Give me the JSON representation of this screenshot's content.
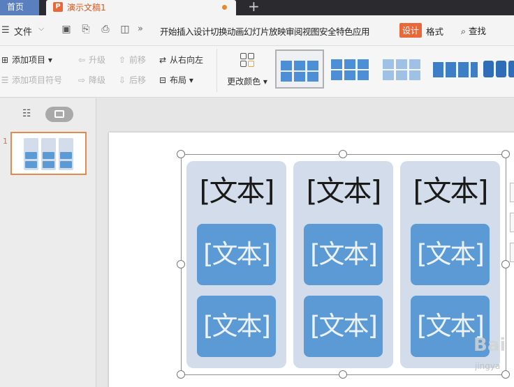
{
  "tabs": {
    "home": "首页",
    "document": "演示文稿1",
    "doc_logo": "P",
    "add": "+"
  },
  "menubar": {
    "file": "文件",
    "more": "»",
    "items": "开始插入设计切换动画幻灯片放映审阅视图安全特色应用",
    "design": "设计",
    "format": "格式",
    "search": "查找"
  },
  "ribbon": {
    "add_item": "添加项目",
    "add_bullet": "添加项目符号",
    "promote": "升级",
    "demote": "降级",
    "move_up": "前移",
    "move_down": "后移",
    "right_to_left": "从右向左",
    "layout": "布局",
    "change_color": "更改颜色"
  },
  "thumbnail": {
    "slide_number": "1"
  },
  "slide": {
    "columns": [
      {
        "header": "[文本]",
        "items": [
          "[文本]",
          "[文本]"
        ]
      },
      {
        "header": "[文本]",
        "items": [
          "[文本]",
          "[文本]"
        ]
      },
      {
        "header": "[文本]",
        "items": [
          "[文本]",
          "[文本]"
        ]
      }
    ]
  },
  "watermark": {
    "logo": "Bai",
    "sub": "jingya"
  },
  "colors": {
    "accent": "#e8683a",
    "box_blue": "#5b9ad4",
    "panel_bg": "#d3dcea"
  }
}
